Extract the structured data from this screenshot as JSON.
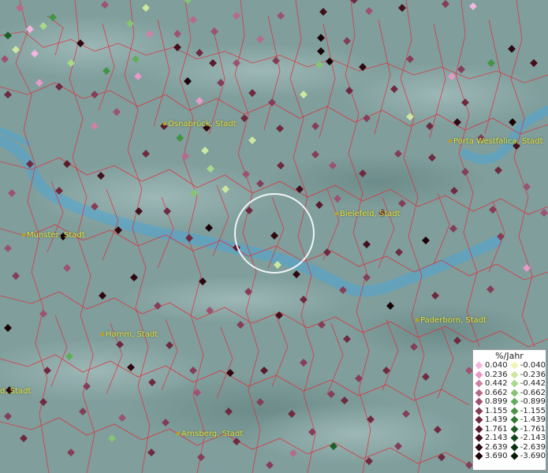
{
  "map": {
    "cities": [
      {
        "label": "Osnabrück, Stadt"
      },
      {
        "label": "Porta Westfalica, Stadt"
      },
      {
        "label": "Bielefeld, Stadt"
      },
      {
        "label": "Münster, Stadt"
      },
      {
        "label": "Paderborn, Stadt"
      },
      {
        "label": "Hamm, Stadt"
      },
      {
        "label": "d, Stadt"
      },
      {
        "label": "Arnsberg, Stadt"
      }
    ],
    "selection_circle": {
      "visible": true
    }
  },
  "legend": {
    "title": "%/Jahr",
    "positive": [
      {
        "label": "0.040",
        "color": "#f2b6e0"
      },
      {
        "label": "0.236",
        "color": "#e59ac8"
      },
      {
        "label": "0.442",
        "color": "#cf80a8"
      },
      {
        "label": "0.662",
        "color": "#b66a8c"
      },
      {
        "label": "0.899",
        "color": "#9c5270"
      },
      {
        "label": "1.155",
        "color": "#853d58"
      },
      {
        "label": "1.439",
        "color": "#6f2a40"
      },
      {
        "label": "1.761",
        "color": "#5a1c2c"
      },
      {
        "label": "2.143",
        "color": "#44101c"
      },
      {
        "label": "2.639",
        "color": "#2f0810"
      },
      {
        "label": "3.690",
        "color": "#1a0206"
      }
    ],
    "negative": [
      {
        "label": "-0.040",
        "color": "#f2f5b0"
      },
      {
        "label": "-0.236",
        "color": "#cce7a0"
      },
      {
        "label": "-0.442",
        "color": "#a8d88a"
      },
      {
        "label": "-0.662",
        "color": "#84c474"
      },
      {
        "label": "-0.899",
        "color": "#62ae5c"
      },
      {
        "label": "-1.155",
        "color": "#459446"
      },
      {
        "label": "-1.439",
        "color": "#2e7a34"
      },
      {
        "label": "-1.761",
        "color": "#1d6026"
      },
      {
        "label": "-2.143",
        "color": "#10481a"
      },
      {
        "label": "-2.639",
        "color": "#083410"
      },
      {
        "label": "-3.690",
        "color": "#031c08"
      }
    ]
  },
  "colors": {
    "background": "#7f9e9c",
    "borders": "#e0303a",
    "river": "#4ea6d6",
    "city_label": "#e8e23a"
  }
}
